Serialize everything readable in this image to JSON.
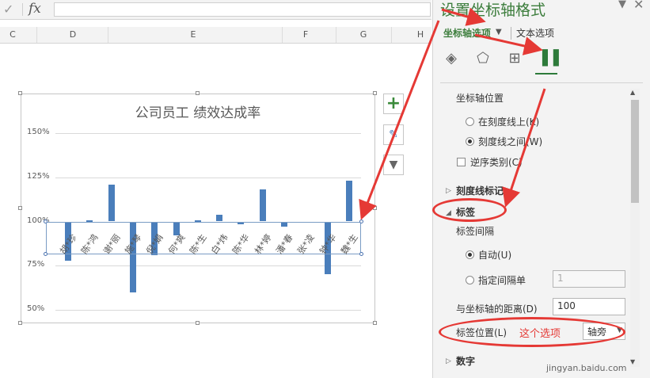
{
  "formula_bar": {
    "check": "✓",
    "fx": "fx"
  },
  "columns": [
    "C",
    "D",
    "E",
    "F",
    "G",
    "H"
  ],
  "chart": {
    "title": "公司员工 绩效达成率",
    "y_ticks": [
      "150%",
      "125%",
      "100%",
      "75%",
      "50%"
    ]
  },
  "chart_data": {
    "type": "bar",
    "title": "公司员工 绩效达成率",
    "categories": [
      "胡*珍",
      "陈*鸿",
      "谢*丽",
      "施*琴",
      "倪*娟",
      "何*爽",
      "陈*生",
      "白*炜",
      "陈*华",
      "林*婷",
      "潘*春",
      "张*凌",
      "钟*华",
      "魏*生"
    ],
    "values": [
      0.78,
      1.005,
      1.21,
      0.6,
      0.81,
      0.92,
      1.005,
      1.04,
      0.985,
      1.18,
      0.97,
      1.0,
      0.7,
      1.23
    ],
    "ylim": [
      0.5,
      1.5
    ],
    "y_format": "percent",
    "axis_crosses": 1.0,
    "grid": true
  },
  "side_buttons": {
    "plus": "+",
    "brush": "✎",
    "filter": "▼"
  },
  "pane": {
    "title": "设置坐标轴格式",
    "collapse": "▼",
    "close": "✕",
    "tab_axis": "坐标轴选项",
    "tab_text": "文本选项",
    "axis_position_heading": "坐标轴位置",
    "radio_on_tick": "在刻度线上(K)",
    "radio_between_tick": "刻度线之间(W)",
    "checkbox_reverse": "逆序类别(C)",
    "section_tickmarks": "刻度线标记",
    "section_labels": "标签",
    "label_interval": "标签间隔",
    "radio_auto": "自动(U)",
    "radio_specify": "指定间隔单",
    "specify_value": "1",
    "distance_label": "与坐标轴的距离(D)",
    "distance_value": "100",
    "label_position_label": "标签位置(L)",
    "label_position_value": "轴旁",
    "section_number": "数字"
  },
  "annotation": {
    "text": "这个选项"
  },
  "watermark": "jingyan.baidu.com",
  "colors": {
    "bar": "#4a7ebb",
    "accent": "#3c7d3c",
    "annotation": "#e53935"
  }
}
